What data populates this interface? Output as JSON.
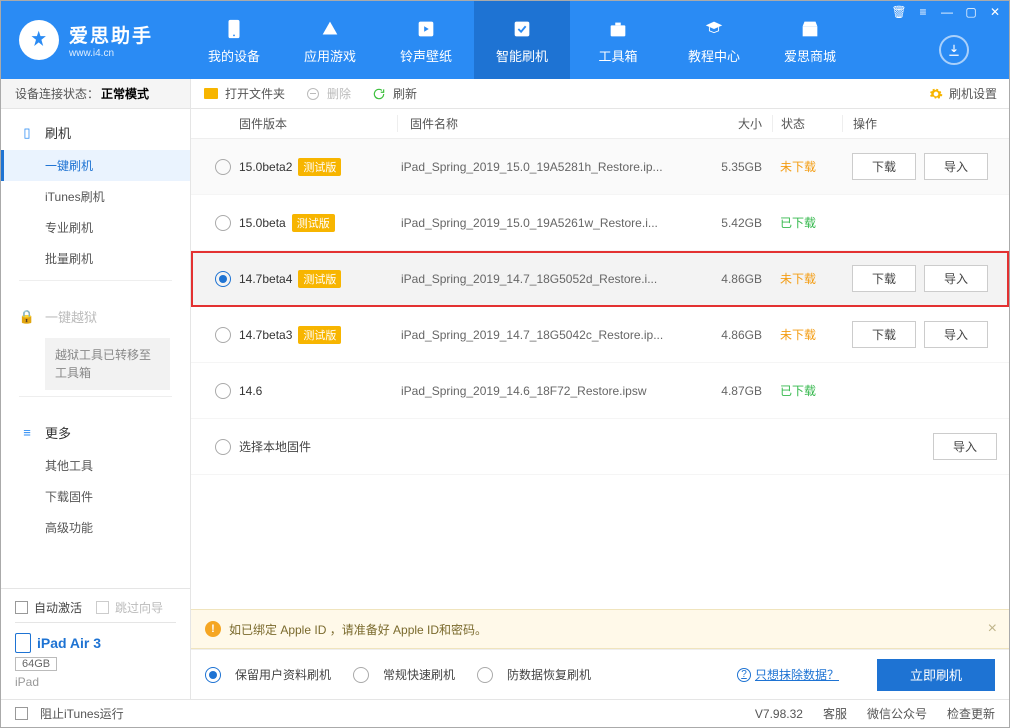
{
  "app": {
    "name_cn": "爱思助手",
    "name_en": "www.i4.cn",
    "titlebar_icons": [
      "trash-icon",
      "menu-icon",
      "minimize-icon",
      "maximize-icon",
      "close-icon"
    ]
  },
  "header_tabs": [
    {
      "id": "device",
      "label": "我的设备",
      "active": false
    },
    {
      "id": "apps",
      "label": "应用游戏",
      "active": false
    },
    {
      "id": "ring",
      "label": "铃声壁纸",
      "active": false
    },
    {
      "id": "flash",
      "label": "智能刷机",
      "active": true
    },
    {
      "id": "tools",
      "label": "工具箱",
      "active": false
    },
    {
      "id": "tutorial",
      "label": "教程中心",
      "active": false
    },
    {
      "id": "store",
      "label": "爱思商城",
      "active": false
    }
  ],
  "sidebar": {
    "conn_label": "设备连接状态：",
    "conn_mode": "正常模式",
    "groups": [
      {
        "head": "刷机",
        "icon": "phone",
        "items": [
          {
            "label": "一键刷机",
            "active": true
          },
          {
            "label": "iTunes刷机"
          },
          {
            "label": "专业刷机"
          },
          {
            "label": "批量刷机"
          }
        ]
      },
      {
        "head": "一键越狱",
        "icon": "lock",
        "dim": true,
        "note": "越狱工具已转移至工具箱",
        "items": []
      },
      {
        "head": "更多",
        "icon": "more",
        "items": [
          {
            "label": "其他工具"
          },
          {
            "label": "下载固件"
          },
          {
            "label": "高级功能"
          }
        ]
      }
    ],
    "bottom": {
      "auto_activate": "自动激活",
      "skip_guide": "跳过向导"
    },
    "device": {
      "name": "iPad Air 3",
      "capacity": "64GB",
      "type": "iPad"
    }
  },
  "toolbar": {
    "open": "打开文件夹",
    "delete": "删除",
    "refresh": "刷新",
    "settings": "刷机设置"
  },
  "table": {
    "headers": {
      "version": "固件版本",
      "name": "固件名称",
      "size": "大小",
      "state": "状态",
      "op": "操作"
    },
    "beta_tag": "测试版",
    "btn_download": "下载",
    "btn_import": "导入",
    "state_not": "未下载",
    "state_done": "已下载",
    "local_label": "选择本地固件",
    "rows": [
      {
        "version": "15.0beta2",
        "beta": true,
        "name": "iPad_Spring_2019_15.0_19A5281h_Restore.ip...",
        "size": "5.35GB",
        "state": "not",
        "ops": [
          "download",
          "import"
        ],
        "selected": false,
        "alt": true
      },
      {
        "version": "15.0beta",
        "beta": true,
        "name": "iPad_Spring_2019_15.0_19A5261w_Restore.i...",
        "size": "5.42GB",
        "state": "done",
        "ops": [],
        "selected": false
      },
      {
        "version": "14.7beta4",
        "beta": true,
        "name": "iPad_Spring_2019_14.7_18G5052d_Restore.i...",
        "size": "4.86GB",
        "state": "not",
        "ops": [
          "download",
          "import"
        ],
        "selected": true,
        "highlight": true
      },
      {
        "version": "14.7beta3",
        "beta": true,
        "name": "iPad_Spring_2019_14.7_18G5042c_Restore.ip...",
        "size": "4.86GB",
        "state": "not",
        "ops": [
          "download",
          "import"
        ],
        "selected": false
      },
      {
        "version": "14.6",
        "beta": false,
        "name": "iPad_Spring_2019_14.6_18F72_Restore.ipsw",
        "size": "4.87GB",
        "state": "done",
        "ops": [],
        "selected": false
      }
    ]
  },
  "notice": "如已绑定 Apple ID ，请准备好 Apple ID和密码。",
  "options": {
    "keep_data": "保留用户资料刷机",
    "normal": "常规快速刷机",
    "antiloss": "防数据恢复刷机",
    "erase_link": "只想抹除数据？",
    "flash_btn": "立即刷机",
    "selected": "keep_data"
  },
  "status": {
    "block_itunes": "阻止iTunes运行",
    "version": "V7.98.32",
    "service": "客服",
    "wechat": "微信公众号",
    "update": "检查更新"
  }
}
